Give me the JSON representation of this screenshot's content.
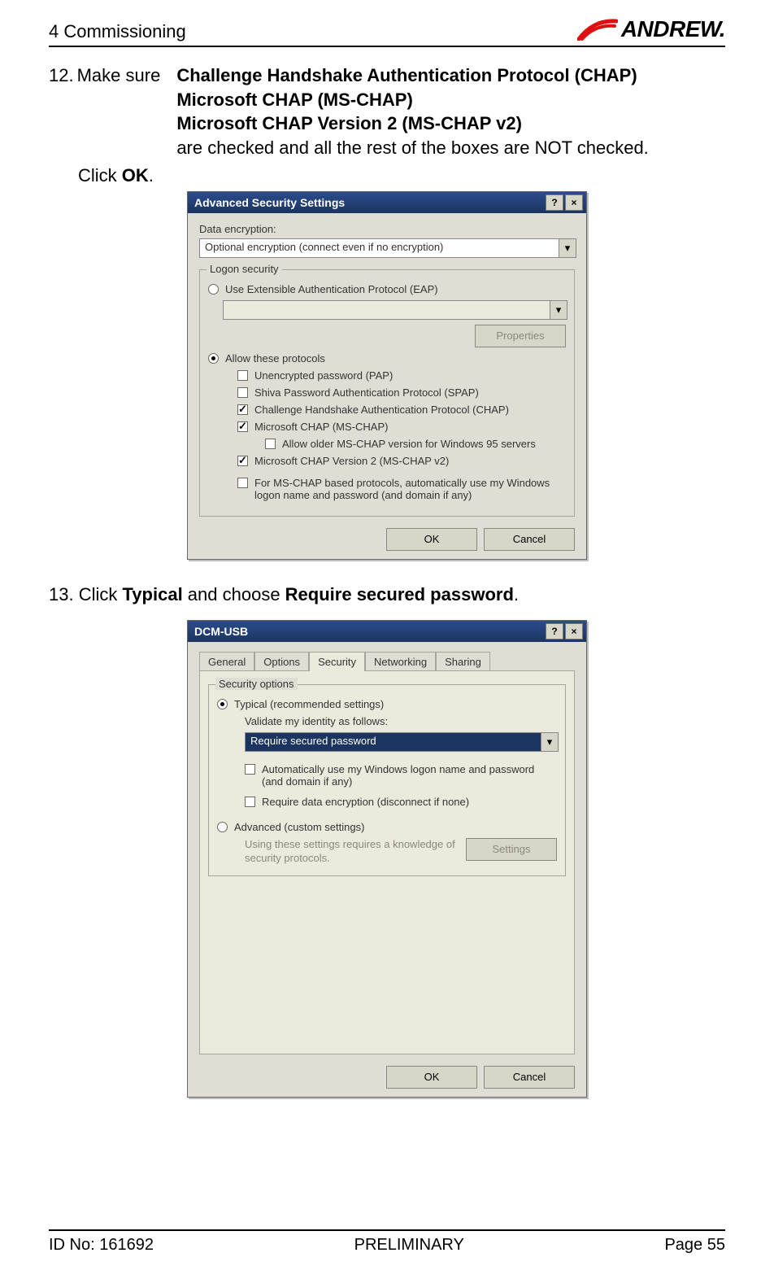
{
  "header": {
    "section_title": "4 Commissioning",
    "brand": "ANDREW."
  },
  "step12": {
    "num": "12.",
    "intro": "Make sure",
    "b1": "Challenge Handshake Authentication Protocol (CHAP)",
    "b2": "Microsoft CHAP (MS-CHAP)",
    "b3": "Microsoft CHAP Version 2 (MS-CHAP v2)",
    "after": "are checked and all the rest of the boxes are NOT checked.",
    "click_ok_pre": "Click ",
    "click_ok_bold": "OK",
    "click_ok_post": "."
  },
  "dialog1": {
    "title": "Advanced Security Settings",
    "help": "?",
    "close": "×",
    "data_encryption_label": "Data encryption:",
    "data_encryption_value": "Optional encryption (connect even if no encryption)",
    "legend": "Logon security",
    "radio_eap": "Use Extensible Authentication Protocol (EAP)",
    "properties_btn": "Properties",
    "radio_allow": "Allow these protocols",
    "chk_pap": "Unencrypted password (PAP)",
    "chk_spap": "Shiva Password Authentication Protocol (SPAP)",
    "chk_chap": "Challenge Handshake Authentication Protocol (CHAP)",
    "chk_mschap": "Microsoft CHAP (MS-CHAP)",
    "chk_older": "Allow older MS-CHAP version for Windows 95 servers",
    "chk_mschap2": "Microsoft CHAP Version 2 (MS-CHAP v2)",
    "chk_auto_logon": "For MS-CHAP based protocols, automatically use my Windows logon name and password (and domain if any)",
    "ok": "OK",
    "cancel": "Cancel"
  },
  "step13": {
    "num": "13.",
    "pre": "Click ",
    "typical": "Typical",
    "mid": " and choose ",
    "req": "Require secured password",
    "post": "."
  },
  "dialog2": {
    "title": "DCM-USB",
    "help": "?",
    "close": "×",
    "tabs": {
      "general": "General",
      "options": "Options",
      "security": "Security",
      "networking": "Networking",
      "sharing": "Sharing"
    },
    "legend": "Security options",
    "radio_typical": "Typical (recommended settings)",
    "validate_label": "Validate my identity as follows:",
    "validate_value": "Require secured password",
    "chk_auto_logon": "Automatically use my Windows logon name and password (and domain if any)",
    "chk_require_enc": "Require data encryption (disconnect if none)",
    "radio_advanced": "Advanced (custom settings)",
    "advanced_note": "Using these settings requires a knowledge of security protocols.",
    "settings_btn": "Settings",
    "ok": "OK",
    "cancel": "Cancel"
  },
  "footer": {
    "id": "ID No: 161692",
    "mid": "PRELIMINARY",
    "page": "Page 55"
  }
}
